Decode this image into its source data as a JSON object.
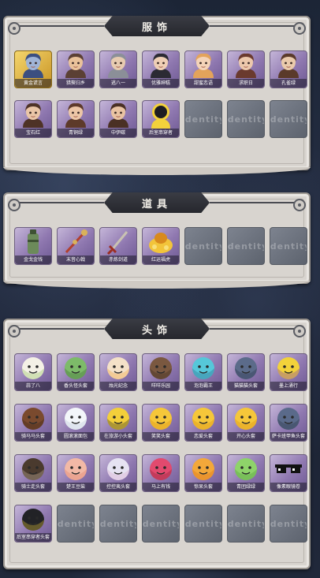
{
  "sections": [
    {
      "title": "服饰",
      "items": [
        {
          "label": "黄金谎言",
          "kind": "portrait",
          "frame": "gold",
          "c1": "#9fb4d6",
          "c2": "#3b4f80"
        },
        {
          "label": "猎獒归乡",
          "kind": "portrait",
          "frame": "purple",
          "c1": "#e9c29a",
          "c2": "#5b4034"
        },
        {
          "label": "逃八一",
          "kind": "portrait",
          "frame": "purple",
          "c1": "#e7cbb0",
          "c2": "#8b8f98"
        },
        {
          "label": "优雅绅糕",
          "kind": "portrait",
          "frame": "purple",
          "c1": "#efcfb5",
          "c2": "#2b2a33"
        },
        {
          "label": "甜蜜恋语",
          "kind": "portrait",
          "frame": "purple",
          "c1": "#f4d3b7",
          "c2": "#e3a35b"
        },
        {
          "label": "求职日",
          "kind": "portrait",
          "frame": "purple",
          "c1": "#ecc8ac",
          "c2": "#6a3a2e"
        },
        {
          "label": "孔雀绿",
          "kind": "portrait",
          "frame": "purple",
          "c1": "#eacaab",
          "c2": "#5a3a2a"
        },
        {
          "label": "宝石红",
          "kind": "portrait",
          "frame": "purple",
          "c1": "#eac5a6",
          "c2": "#4e3226"
        },
        {
          "label": "青铜绿",
          "kind": "portrait",
          "frame": "purple",
          "c1": "#ecc6a6",
          "c2": "#5d3a2a"
        },
        {
          "label": "中伊碳",
          "kind": "portrait",
          "frame": "purple",
          "c1": "#e9c3a2",
          "c2": "#4a3024"
        },
        {
          "label": "后室串穿者",
          "kind": "helmet",
          "frame": "purple",
          "c1": "#f3d23b",
          "c2": "#1d1d22"
        },
        {
          "label": "",
          "kind": "empty"
        },
        {
          "label": "",
          "kind": "empty"
        },
        {
          "label": "",
          "kind": "empty"
        }
      ]
    },
    {
      "title": "道具",
      "items": [
        {
          "label": "金戈金钱",
          "kind": "canister",
          "frame": "purple",
          "c1": "#6c8a5a",
          "c2": "#3e5233"
        },
        {
          "label": "末音心戟",
          "kind": "staff",
          "frame": "purple",
          "c1": "#b2402e",
          "c2": "#d9b25a"
        },
        {
          "label": "赤炼剑道",
          "kind": "sword",
          "frame": "purple",
          "c1": "#9c2d22",
          "c2": "#c9c2b2"
        },
        {
          "label": "红运福虎",
          "kind": "bag",
          "frame": "purple",
          "c1": "#f2c43a",
          "c2": "#d88a1d"
        },
        {
          "label": "",
          "kind": "empty"
        },
        {
          "label": "",
          "kind": "empty"
        },
        {
          "label": "",
          "kind": "empty"
        }
      ]
    },
    {
      "title": "头饰",
      "items": [
        {
          "label": "蒜了八",
          "kind": "round",
          "frame": "purple",
          "c1": "#f4f1e6",
          "c2": "#8fc05a"
        },
        {
          "label": "香头怪头套",
          "kind": "round",
          "frame": "purple",
          "c1": "#7dbb69",
          "c2": "#3d6a33"
        },
        {
          "label": "烛光纪念",
          "kind": "round",
          "frame": "purple",
          "c1": "#f4e1c8",
          "c2": "#f2a33a"
        },
        {
          "label": "咩咩乐园",
          "kind": "round",
          "frame": "purple",
          "c1": "#7a5840",
          "c2": "#3a2a20"
        },
        {
          "label": "泡泡霸王",
          "kind": "round",
          "frame": "purple",
          "c1": "#56c7d9",
          "c2": "#2a6a8a"
        },
        {
          "label": "猫猫猫头套",
          "kind": "round",
          "frame": "purple",
          "c1": "#5b6b8a",
          "c2": "#2c344a"
        },
        {
          "label": "墨上涌行",
          "kind": "round",
          "frame": "purple",
          "c1": "#f2d23a",
          "c2": "#7a3fb3"
        },
        {
          "label": "骑马马头套",
          "kind": "round",
          "frame": "purple",
          "c1": "#7a4a2e",
          "c2": "#3b2418"
        },
        {
          "label": "圆滚滚面包",
          "kind": "round",
          "frame": "purple",
          "c1": "#f3f6fa",
          "c2": "#b9c6d8"
        },
        {
          "label": "在旅游小头套",
          "kind": "round",
          "frame": "purple",
          "c1": "#f3cf3a",
          "c2": "#2a2a2a"
        },
        {
          "label": "笑笑头套",
          "kind": "round",
          "frame": "purple",
          "c1": "#f5c73a",
          "c2": "#d98f12"
        },
        {
          "label": "恋爱头套",
          "kind": "round",
          "frame": "purple",
          "c1": "#f5c73a",
          "c2": "#d98f12"
        },
        {
          "label": "开心头套",
          "kind": "round",
          "frame": "purple",
          "c1": "#f5c73a",
          "c2": "#d98f12"
        },
        {
          "label": "萨卡班甲鱼头套",
          "kind": "round",
          "frame": "purple",
          "c1": "#5a6a8a",
          "c2": "#2c3446"
        },
        {
          "label": "骑士走头套",
          "kind": "round",
          "frame": "purple",
          "c1": "#4a3a2e",
          "c2": "#c9b8a0"
        },
        {
          "label": "楚王豆柴",
          "kind": "round",
          "frame": "purple",
          "c1": "#f2b9a6",
          "c2": "#e07e6a"
        },
        {
          "label": "控控夷头套",
          "kind": "round",
          "frame": "purple",
          "c1": "#e6e3f2",
          "c2": "#d6a6cf"
        },
        {
          "label": "马上有钱",
          "kind": "round",
          "frame": "purple",
          "c1": "#e24a6e",
          "c2": "#8a1f3a"
        },
        {
          "label": "惊呆头套",
          "kind": "round",
          "frame": "purple",
          "c1": "#f3a83a",
          "c2": "#d9701a"
        },
        {
          "label": "青团绿绿",
          "kind": "round",
          "frame": "purple",
          "c1": "#8ed36a",
          "c2": "#4f9a3a"
        },
        {
          "label": "像素眼镜卷",
          "kind": "glasses",
          "frame": "purple",
          "c1": "#111111",
          "c2": "#333333"
        },
        {
          "label": "后室串穿者头套",
          "kind": "round",
          "frame": "purple",
          "c1": "#222226",
          "c2": "#e2c23a"
        },
        {
          "label": "",
          "kind": "empty"
        },
        {
          "label": "",
          "kind": "empty"
        },
        {
          "label": "",
          "kind": "empty"
        },
        {
          "label": "",
          "kind": "empty"
        },
        {
          "label": "",
          "kind": "empty"
        },
        {
          "label": "",
          "kind": "empty"
        }
      ]
    }
  ],
  "empty_watermark": "Identity"
}
